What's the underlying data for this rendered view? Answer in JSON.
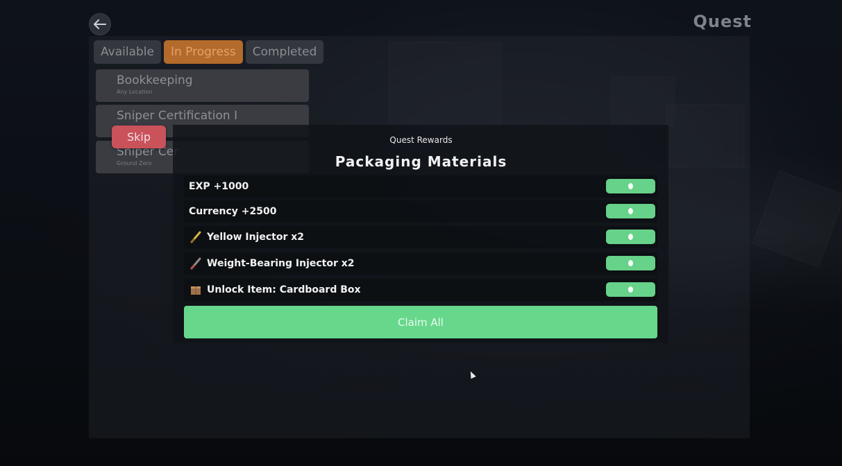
{
  "header": {
    "title": "Quest"
  },
  "tabs": [
    {
      "label": "Available",
      "active": false
    },
    {
      "label": "In Progress",
      "active": true
    },
    {
      "label": "Completed",
      "active": false
    }
  ],
  "quests": [
    {
      "name": "Bookkeeping",
      "location": "Any Location"
    },
    {
      "name": "Sniper Certification I",
      "location": ""
    },
    {
      "name": "Sniper Cer",
      "location": "Ground Zero"
    }
  ],
  "skip_label": "Skip",
  "modal": {
    "subtitle": "Quest Rewards",
    "title": "Packaging Materials",
    "rewards": [
      {
        "label": "EXP +1000",
        "icon": ""
      },
      {
        "label": "Currency +2500",
        "icon": ""
      },
      {
        "label": "Yellow Injector x2",
        "icon": "yellow-injector-icon"
      },
      {
        "label": "Weight-Bearing Injector x2",
        "icon": "weight-bearing-injector-icon"
      },
      {
        "label": "Unlock Item: Cardboard Box",
        "icon": "cardboard-box-icon"
      }
    ],
    "claim_label": "Claim All"
  },
  "colors": {
    "accent_green": "#67d88b",
    "active_tab": "#b36a2a",
    "skip_red": "#c9525b"
  }
}
